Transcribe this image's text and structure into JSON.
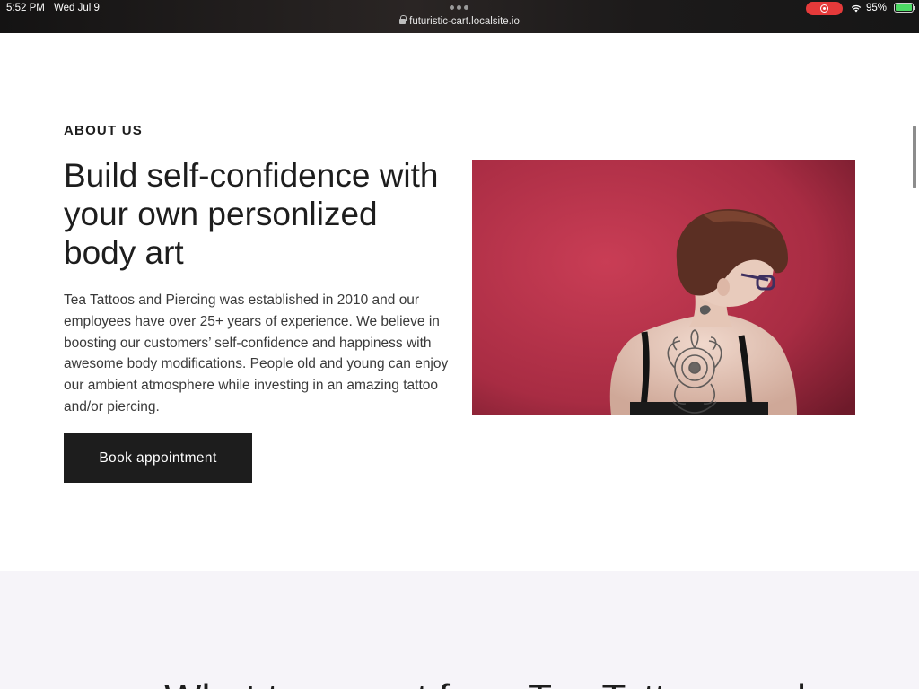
{
  "status_bar": {
    "time": "5:52 PM",
    "date": "Wed Jul 9",
    "url": "futuristic-cart.localsite.io",
    "battery": "95%",
    "record_icon": "screen-record-icon",
    "wifi_icon": "wifi-icon",
    "battery_icon": "battery-charging-icon",
    "colors": {
      "record": "#e53a3a",
      "battery": "#4cd964"
    }
  },
  "about": {
    "eyebrow": "ABOUT US",
    "headline": "Build self-confidence with your own personlized body art",
    "body": "Tea Tattoos and Piercing was established in 2010 and our employees have over 25+ years of experience. We believe in boosting our customers’ self-confidence and happiness with awesome body modifications. People old and young can enjoy our ambient atmosphere while investing in an amazing tattoo and/or piercing.",
    "cta_label": "Book appointment",
    "colors": {
      "button_bg": "#1d1d1d",
      "photo_bg": "#b8334a"
    }
  },
  "next_section": {
    "heading": "What to expect from Tea Tattoos and"
  }
}
